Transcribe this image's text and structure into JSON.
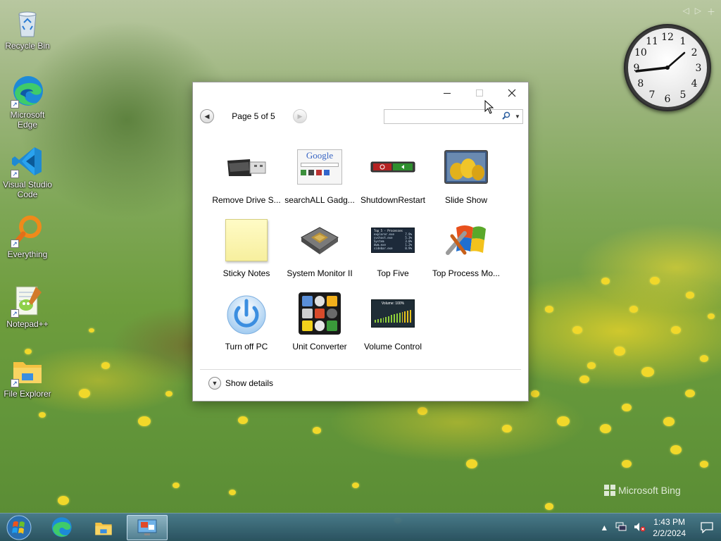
{
  "desktop": {
    "icons": [
      {
        "label": "Recycle Bin",
        "icon": "recycle-bin-icon"
      },
      {
        "label": "Microsoft Edge",
        "icon": "edge-icon"
      },
      {
        "label": "Visual Studio Code",
        "icon": "vscode-icon"
      },
      {
        "label": "Everything",
        "icon": "everything-icon"
      },
      {
        "label": "Notepad++",
        "icon": "notepadpp-icon"
      },
      {
        "label": "File Explorer",
        "icon": "file-explorer-icon"
      }
    ],
    "watermark": "Microsoft Bing"
  },
  "gadget_window": {
    "pager": {
      "label": "Page 5 of 5"
    },
    "search": {
      "value": "",
      "placeholder": ""
    },
    "gadgets": [
      {
        "label": "Remove Drive S...",
        "icon": "usb-drive-icon"
      },
      {
        "label": "searchALL Gadg...",
        "icon": "google-search-icon"
      },
      {
        "label": "ShutdownRestart",
        "icon": "shutdown-restart-icon"
      },
      {
        "label": "Slide Show",
        "icon": "slide-show-icon"
      },
      {
        "label": "Sticky Notes",
        "icon": "sticky-note-icon"
      },
      {
        "label": "System Monitor II",
        "icon": "cpu-chip-icon"
      },
      {
        "label": "Top Five",
        "icon": "top-five-icon"
      },
      {
        "label": "Top Process Mo...",
        "icon": "process-monitor-icon"
      },
      {
        "label": "Turn off PC",
        "icon": "power-icon"
      },
      {
        "label": "Unit Converter",
        "icon": "unit-converter-icon"
      },
      {
        "label": "Volume Control",
        "icon": "volume-control-icon"
      }
    ],
    "details_label": "Show details",
    "top_five_thumb": {
      "title": "Top 5 - Processes",
      "rows": [
        {
          "name": "explorer.exe",
          "value": "7.9%"
        },
        {
          "name": "svchost.exe",
          "value": "5.3%"
        },
        {
          "name": "System",
          "value": "3.0%"
        },
        {
          "name": "dwm.exe",
          "value": "1.2%"
        },
        {
          "name": "sidebar.exe",
          "value": "0.9%"
        }
      ]
    },
    "volume_thumb": {
      "label": "Volume: 100%"
    },
    "google_thumb": {
      "label": "Google"
    }
  },
  "clock_gadget": {
    "numbers": [
      "12",
      "1",
      "2",
      "3",
      "4",
      "5",
      "6",
      "7",
      "8",
      "9",
      "10",
      "11"
    ]
  },
  "taskbar": {
    "time": "1:43 PM",
    "date": "2/2/2024"
  }
}
